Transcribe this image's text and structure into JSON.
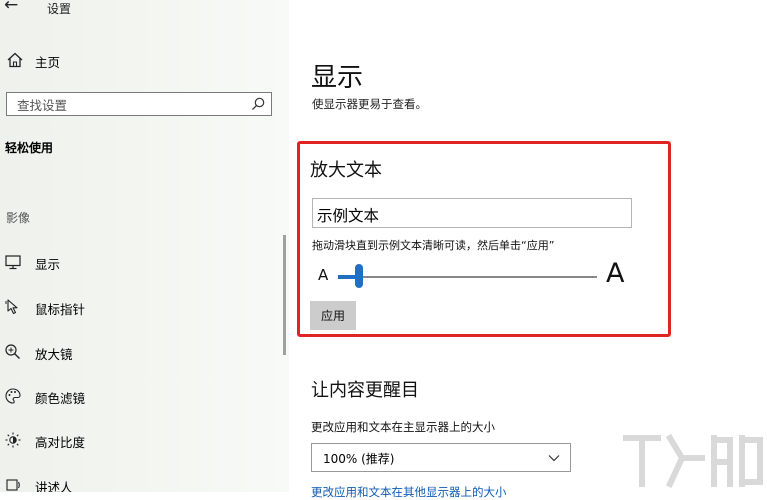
{
  "window": {
    "back": "←",
    "title": "设置"
  },
  "sidebar": {
    "home": "主页",
    "search_placeholder": "查找设置",
    "section": "轻松使用",
    "group_label": "影像",
    "items": [
      {
        "label": "显示",
        "icon": "monitor-icon"
      },
      {
        "label": "鼠标指针",
        "icon": "mouse-pointer-icon"
      },
      {
        "label": "放大镜",
        "icon": "magnifier-icon"
      },
      {
        "label": "颜色滤镜",
        "icon": "palette-icon"
      },
      {
        "label": "高对比度",
        "icon": "contrast-icon"
      },
      {
        "label": "讲述人",
        "icon": "narrator-icon"
      }
    ]
  },
  "main": {
    "title": "显示",
    "description": "使显示器更易于查看。",
    "enlarge": {
      "title": "放大文本",
      "sample_text": "示例文本",
      "instruction": "拖动滑块直到示例文本清晰可读，然后单击“应用”",
      "small_a": "A",
      "large_a": "A",
      "slider_value": 0.08,
      "apply_label": "应用"
    },
    "emphasis": {
      "title": "让内容更醒目",
      "size_label": "更改应用和文本在主显示器上的大小",
      "size_value": "100% (推荐)",
      "link_text": "更改应用和文本在其他显示器上的大小"
    }
  },
  "colors": {
    "accent": "#1f6fc2",
    "highlight": "#e02424",
    "link": "#0f5bb5"
  }
}
